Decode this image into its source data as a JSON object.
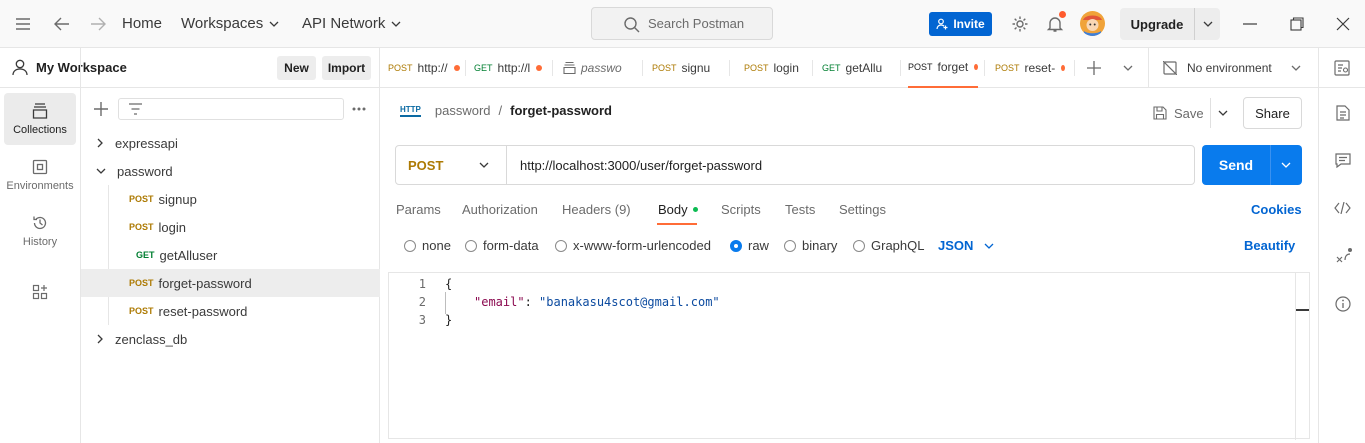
{
  "topbar": {
    "home": "Home",
    "workspaces": "Workspaces",
    "api_network": "API Network",
    "search_placeholder": "Search Postman",
    "invite": "Invite",
    "upgrade": "Upgrade"
  },
  "workspace": {
    "name": "My Workspace",
    "new_label": "New",
    "import_label": "Import"
  },
  "leftnav": [
    {
      "label": "Collections",
      "icon": "collections-icon",
      "active": true
    },
    {
      "label": "Environments",
      "icon": "environments-icon",
      "active": false
    },
    {
      "label": "History",
      "icon": "history-icon",
      "active": false
    },
    {
      "label": "",
      "icon": "apps-grid-icon",
      "active": false
    }
  ],
  "tree": [
    {
      "label": "expressapi",
      "type": "collection",
      "expanded": false
    },
    {
      "label": "password",
      "type": "collection",
      "expanded": true
    },
    {
      "label": "signup",
      "method": "POST"
    },
    {
      "label": "login",
      "method": "POST"
    },
    {
      "label": "getAlluser",
      "method": "GET"
    },
    {
      "label": "forget-password",
      "method": "POST",
      "selected": true
    },
    {
      "label": "reset-password",
      "method": "POST"
    },
    {
      "label": "zenclass_db",
      "type": "collection",
      "expanded": false
    }
  ],
  "tabs": [
    {
      "method": "POST",
      "name": "http://",
      "dirty": true
    },
    {
      "method": "GET",
      "name": "http://l",
      "dirty": true
    },
    {
      "method": "",
      "name": "passwo",
      "dirty": false
    },
    {
      "method": "POST",
      "name": "signu",
      "dirty": false
    },
    {
      "method": "POST",
      "name": "login",
      "dirty": false
    },
    {
      "method": "GET",
      "name": "getAllu",
      "dirty": false
    },
    {
      "method": "POST",
      "name": "forget",
      "dirty": true,
      "active": true
    },
    {
      "method": "POST",
      "name": "reset-",
      "dirty": true
    }
  ],
  "environment": "No environment",
  "request": {
    "breadcrumb_parent": "password",
    "breadcrumb_sep": "/",
    "breadcrumb_current": "forget-password",
    "http_badge": "HTTP",
    "save": "Save",
    "share": "Share",
    "method": "POST",
    "url": "http://localhost:3000/user/forget-password",
    "send": "Send"
  },
  "subtabs": {
    "params": "Params",
    "authorization": "Authorization",
    "headers": "Headers (9)",
    "body": "Body",
    "scripts": "Scripts",
    "tests": "Tests",
    "settings": "Settings",
    "cookies": "Cookies"
  },
  "body_modes": {
    "none": "none",
    "form_data": "form-data",
    "urlencoded": "x-www-form-urlencoded",
    "raw": "raw",
    "binary": "binary",
    "graphql": "GraphQL",
    "selected": "raw",
    "format": "JSON",
    "beautify": "Beautify"
  },
  "editor": {
    "line_numbers": [
      "1",
      "2",
      "3"
    ],
    "open": "{",
    "key": "\"email\"",
    "colon": ": ",
    "value": "\"banakasu4scot@gmail.com\"",
    "close": "}"
  },
  "colors": {
    "post": "#ad7a03",
    "get": "#007f31",
    "accent": "#ff6c37",
    "primary": "#097bed"
  }
}
